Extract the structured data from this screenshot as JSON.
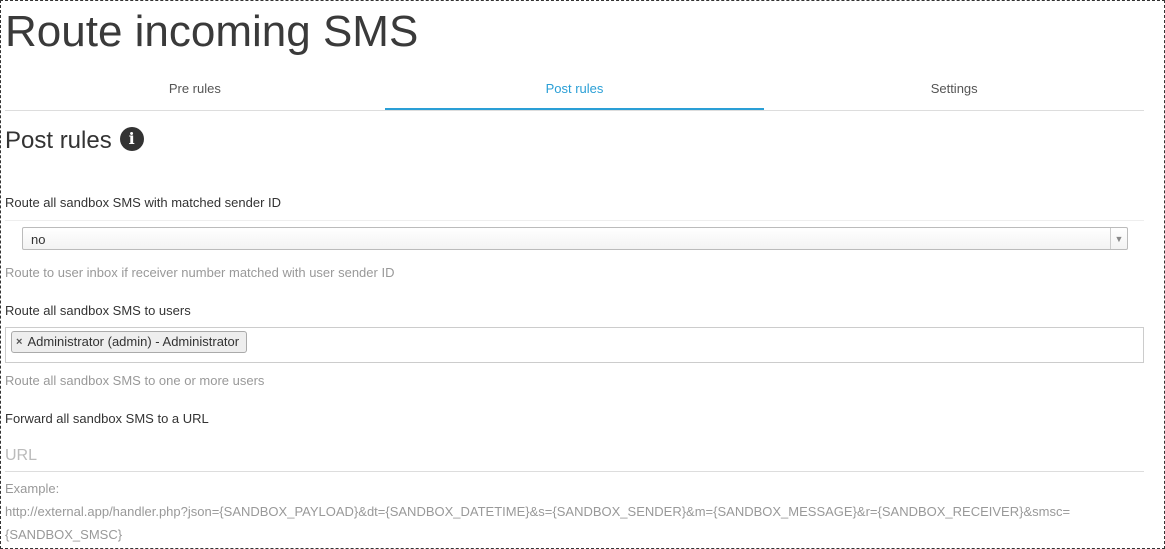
{
  "page": {
    "title": "Route incoming SMS"
  },
  "tabs": [
    {
      "label": "Pre rules",
      "active": false
    },
    {
      "label": "Post rules",
      "active": true
    },
    {
      "label": "Settings",
      "active": false
    }
  ],
  "section": {
    "title": "Post rules",
    "icon": "info-circle-icon"
  },
  "matched_sender": {
    "label": "Route all sandbox SMS with matched sender ID",
    "value": "no",
    "help": "Route to user inbox if receiver number matched with user sender ID"
  },
  "route_users": {
    "label": "Route all sandbox SMS to users",
    "selected": [
      "Administrator (admin) - Administrator"
    ],
    "help": "Route all sandbox SMS to one or more users"
  },
  "forward_url": {
    "label": "Forward all sandbox SMS to a URL",
    "placeholder": "URL",
    "example_label": "Example:",
    "example_line1": "http://external.app/handler.php?json={SANDBOX_PAYLOAD}&dt={SANDBOX_DATETIME}&s={SANDBOX_SENDER}&m={SANDBOX_MESSAGE}&r={SANDBOX_RECEIVER}&smsc=",
    "example_line2": "{SANDBOX_SMSC}"
  },
  "colors": {
    "accent": "#2a9fd6",
    "text": "#333333",
    "muted": "#999999"
  }
}
